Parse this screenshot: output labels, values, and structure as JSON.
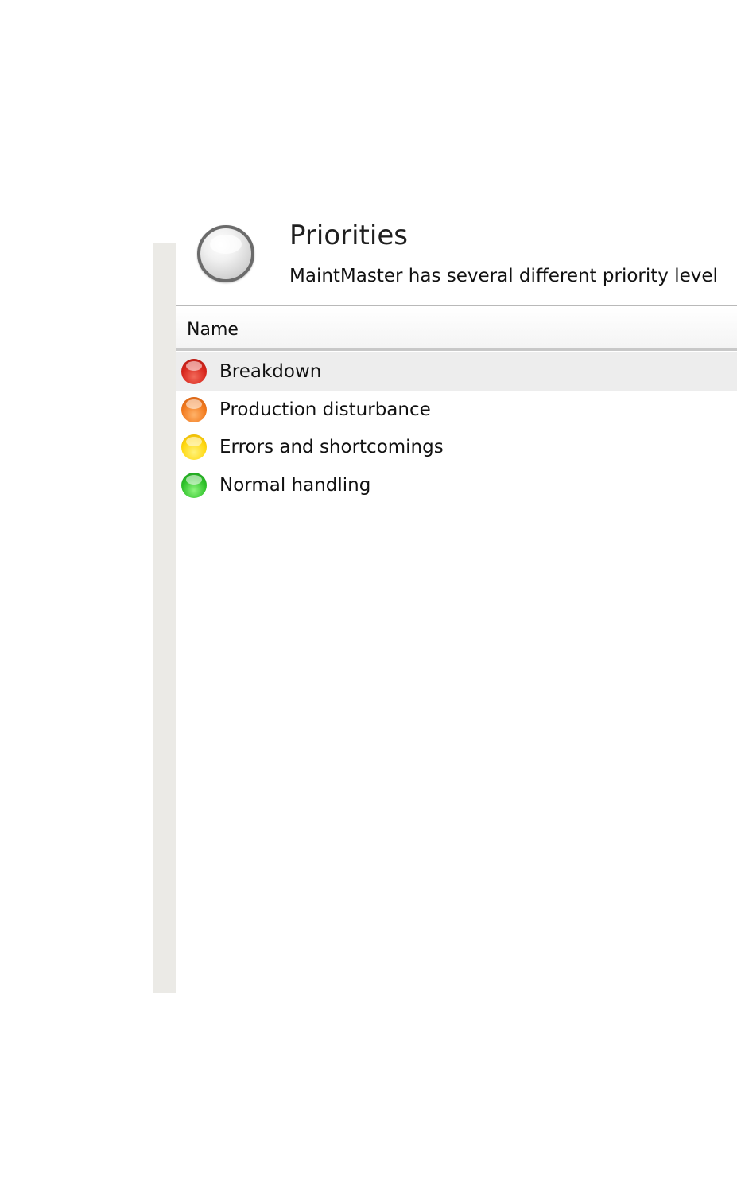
{
  "header": {
    "title": "Priorities",
    "description": "MaintMaster has several different priority level",
    "icon": "priority-gray-circle-icon"
  },
  "table": {
    "column_header": "Name",
    "rows": [
      {
        "label": "Breakdown",
        "icon": "red-priority-icon",
        "color": "#d8261c",
        "selected": true
      },
      {
        "label": "Production disturbance",
        "icon": "orange-priority-icon",
        "color": "#f27a1e",
        "selected": false
      },
      {
        "label": "Errors and shortcomings",
        "icon": "yellow-priority-icon",
        "color": "#ffd810",
        "selected": false
      },
      {
        "label": "Normal handling",
        "icon": "green-priority-icon",
        "color": "#2fc22a",
        "selected": false
      }
    ]
  }
}
